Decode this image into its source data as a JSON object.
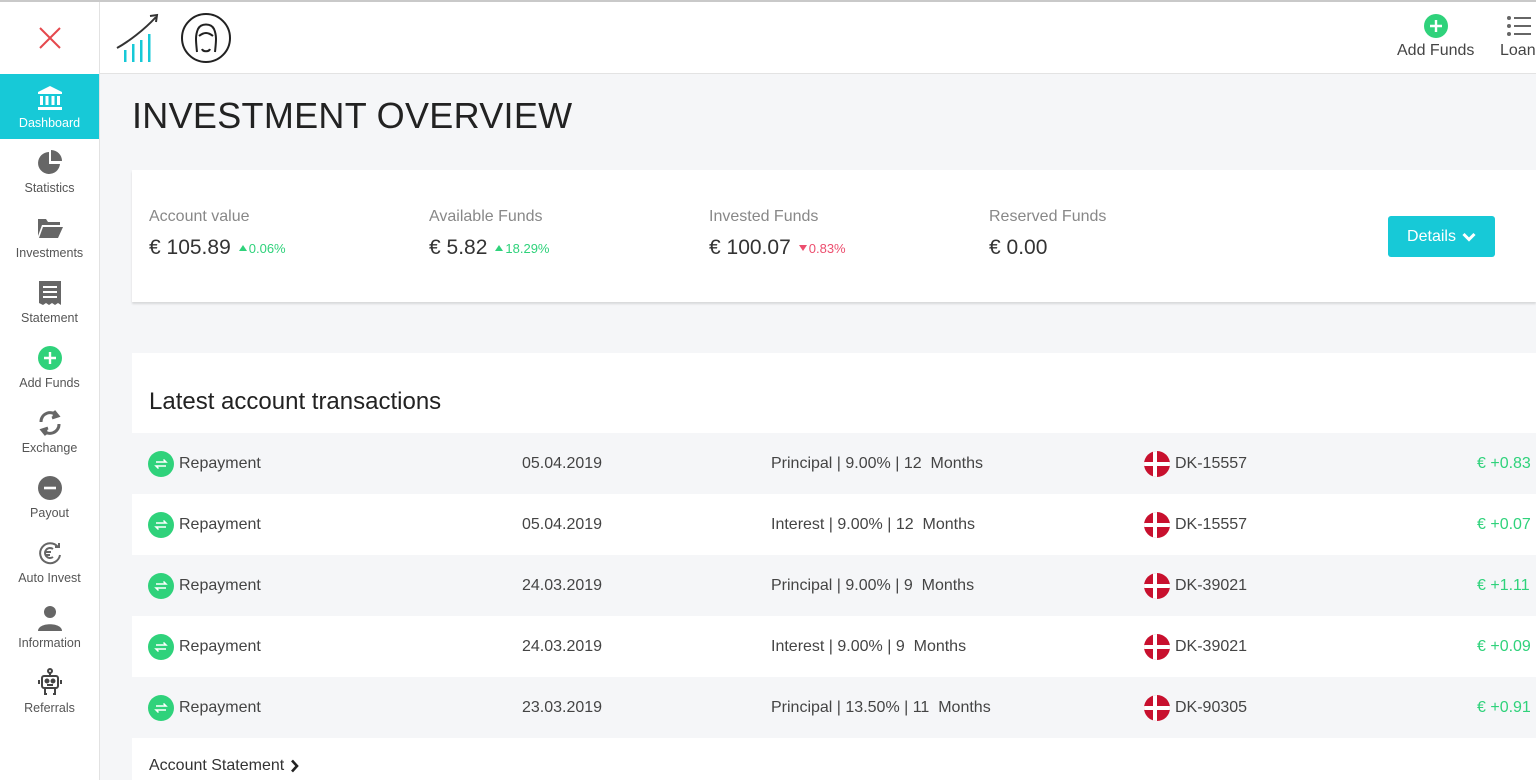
{
  "colors": {
    "accent": "#17c9d7",
    "positive": "#2fd27b",
    "negative": "#ec4e6e",
    "close": "#e5484d"
  },
  "sidebar": {
    "items": [
      {
        "label": "Dashboard",
        "icon": "bank-icon",
        "active": true
      },
      {
        "label": "Statistics",
        "icon": "pie-chart-icon"
      },
      {
        "label": "Investments",
        "icon": "folder-open-icon"
      },
      {
        "label": "Statement",
        "icon": "receipt-icon"
      },
      {
        "label": "Add Funds",
        "icon": "plus-circle-icon"
      },
      {
        "label": "Exchange",
        "icon": "refresh-icon"
      },
      {
        "label": "Payout",
        "icon": "minus-circle-icon"
      },
      {
        "label": "Auto Invest",
        "icon": "euro-cycle-icon"
      },
      {
        "label": "Information",
        "icon": "user-icon"
      },
      {
        "label": "Referrals",
        "icon": "robot-icon"
      }
    ]
  },
  "header": {
    "add_funds_label": "Add Funds",
    "loans_label": "Loan"
  },
  "page": {
    "title": "INVESTMENT OVERVIEW"
  },
  "summary": {
    "account_value": {
      "label": "Account value",
      "value": "€ 105.89",
      "change": "0.06%"
    },
    "available_funds": {
      "label": "Available Funds",
      "value": "€ 5.82",
      "change": "18.29%"
    },
    "invested_funds": {
      "label": "Invested Funds",
      "value": "€ 100.07",
      "change": "0.83%"
    },
    "reserved_funds": {
      "label": "Reserved Funds",
      "value": "€ 0.00"
    },
    "details_label": "Details"
  },
  "transactions": {
    "title": "Latest account transactions",
    "rows": [
      {
        "type": "Repayment",
        "date": "05.04.2019",
        "desc": "Principal | 9.00% | 12  Months",
        "loan": "DK-15557",
        "amount": "€ +0.83"
      },
      {
        "type": "Repayment",
        "date": "05.04.2019",
        "desc": "Interest | 9.00% | 12  Months",
        "loan": "DK-15557",
        "amount": "€ +0.07"
      },
      {
        "type": "Repayment",
        "date": "24.03.2019",
        "desc": "Principal | 9.00% | 9  Months",
        "loan": "DK-39021",
        "amount": "€ +1.11"
      },
      {
        "type": "Repayment",
        "date": "24.03.2019",
        "desc": "Interest | 9.00% | 9  Months",
        "loan": "DK-39021",
        "amount": "€ +0.09"
      },
      {
        "type": "Repayment",
        "date": "23.03.2019",
        "desc": "Principal | 13.50% | 11  Months",
        "loan": "DK-90305",
        "amount": "€ +0.91"
      }
    ],
    "statement_link": "Account Statement"
  }
}
